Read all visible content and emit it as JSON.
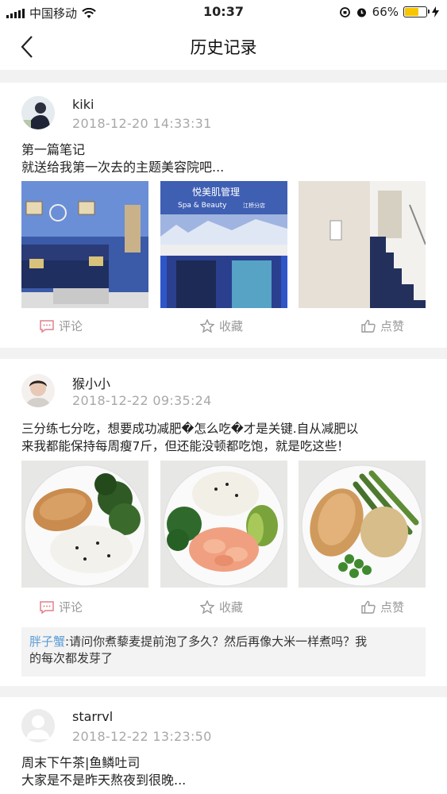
{
  "status_bar": {
    "carrier": "中国移动",
    "time": "10:37",
    "battery": "66%",
    "battery_level": 0.66
  },
  "nav": {
    "title": "历史记录"
  },
  "posts": [
    {
      "user": "kiki",
      "time": "2018-12-20  14:33:31",
      "text_lines": [
        "第一篇笔记",
        "就送给我第一次去的主题美容院吧..."
      ],
      "photos": [
        "spa-interior-photo",
        "spa-storefront-photo",
        "spa-staircase-photo"
      ],
      "store_sign": {
        "title": "悦美肌管理",
        "subtitle": "Spa & Beauty",
        "branch": "江桥分店"
      },
      "actions": {
        "comment": "评论",
        "favorite": "收藏",
        "like": "点赞"
      }
    },
    {
      "user": "猴小小",
      "time": "2018-12-22  09:35:24",
      "text_lines": [
        "三分练七分吃，想要成功减肥�怎么吃�才是关键.自从减肥以",
        "来我都能保持每周瘦7斤，但还能没顿都吃饱，就是吃这些！"
      ],
      "photos": [
        "salmon-broccoli-rice-plate",
        "shrimp-rice-avocado-plate",
        "chicken-asparagus-quinoa-plate"
      ],
      "actions": {
        "comment": "评论",
        "favorite": "收藏",
        "like": "点赞"
      },
      "comment": {
        "author": "胖子蟹",
        "text_1": ":请问你煮藜麦提前泡了多久？然后再像大米一样煮吗？我",
        "text_2": "的每次都发芽了"
      }
    },
    {
      "user": "starrvl",
      "time": "2018-12-22  13:23:50",
      "text_lines": [
        "周末下午茶|鱼鳞吐司",
        "大家是不是昨天熬夜到很晚..."
      ]
    }
  ],
  "colors": {
    "comment_name": "#5b9bd5",
    "comment_icon": "#e0808a",
    "meta": "#a8a8a8",
    "battery": "#f7c600"
  }
}
